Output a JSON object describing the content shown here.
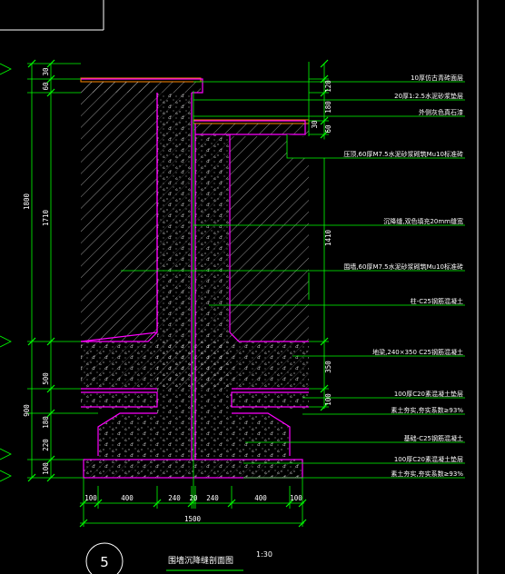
{
  "colors": {
    "background": "#000000",
    "dimension": "#00ff00",
    "wall_outline": "#ff00ff",
    "leader": "#00ff00",
    "hatch": "#ffffff",
    "finish": "#ff8800",
    "text": "#ffffff"
  },
  "annotations": [
    "10厚仿古青砖面层",
    "20厚1:2.5水泥砂浆垫层",
    "外侧灰色真石漆",
    "压顶,60厚M7.5水泥砂浆砌筑Mu10标准砖",
    "沉降缝,双色填充20mm缝宽",
    "围墙,60厚M7.5水泥砂浆砌筑Mu10标准砖",
    "柱-C25钢筋混凝土",
    "地梁,240×350 C25钢筋混凝土",
    "100厚C20素混凝土垫层",
    "素土夯实,夯实系数≥93%",
    "基础-C25钢筋混凝土",
    "100厚C20素混凝土垫层",
    "素土夯实,夯实系数≥93%"
  ],
  "left_dims_outer": [
    "1800",
    "900"
  ],
  "left_dims_inner": [
    "30",
    "60",
    "1710",
    "500",
    "180",
    "220",
    "100"
  ],
  "right_dims": [
    "120",
    "180",
    "30",
    "60",
    "1410",
    "350",
    "100"
  ],
  "bottom_dims": [
    "100",
    "400",
    "240",
    "20",
    "240",
    "400",
    "100"
  ],
  "overall_dim": "1500",
  "detail_number": "5",
  "title": "围墙沉降缝剖面图",
  "scale": "1:30"
}
